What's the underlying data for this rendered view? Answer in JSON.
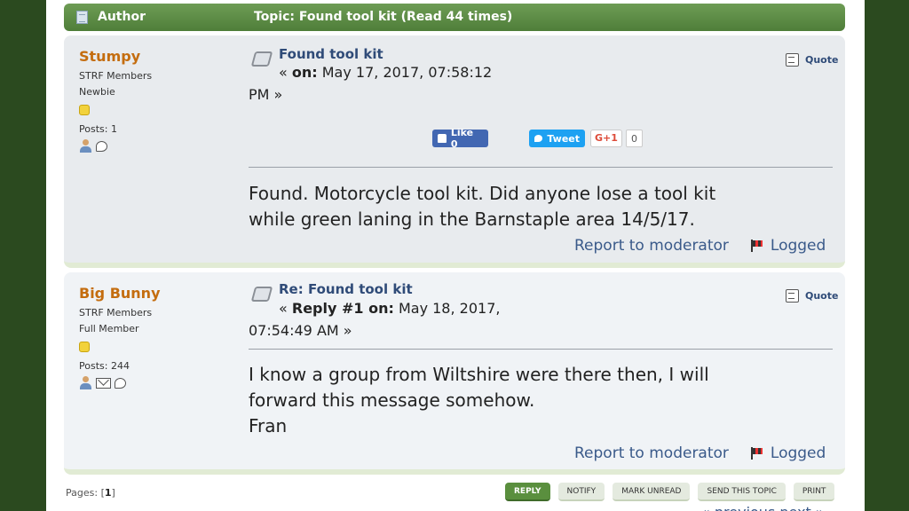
{
  "header": {
    "author_label": "Author",
    "topic_label": "Topic: Found tool kit  (Read 44 times)"
  },
  "posts": [
    {
      "name": "Stumpy",
      "group": "STRF Members",
      "rank": "Newbie",
      "posts_label": "Posts: 1",
      "subject": "Found tool kit",
      "date_prefix": "« ",
      "date_on": "on:",
      "date_line1": " May 17, 2017, 07:58:12",
      "date_line2": "PM »",
      "quote_label": "Quote",
      "social": {
        "like": "Like 0",
        "tweet": "Tweet",
        "gplus": "G+1",
        "gplus_count": "0"
      },
      "body": "Found. Motorcycle tool kit. Did anyone lose a tool kit\nwhile green laning in the Barnstaple area 14/5/17.",
      "report_label": "Report to moderator",
      "logged_label": "Logged"
    },
    {
      "name": "Big Bunny",
      "group": "STRF Members",
      "rank": "Full Member",
      "posts_label": "Posts: 244",
      "subject": "Re: Found tool kit",
      "date_prefix": "« ",
      "date_on": "Reply #1 on:",
      "date_line1": " May 18, 2017,",
      "date_line2": "07:54:49 AM »",
      "quote_label": "Quote",
      "body": "I know a group from Wiltshire were there then,  I will\nforward this message somehow.\nFran",
      "report_label": "Report to moderator",
      "logged_label": "Logged"
    }
  ],
  "pagination": {
    "label": "Pages: [",
    "current": "1",
    "close": "]"
  },
  "buttons": [
    "REPLY",
    "NOTIFY",
    "MARK UNREAD",
    "SEND THIS TOPIC",
    "PRINT"
  ],
  "nav": "« previous next »",
  "colors": {
    "background": "#2b4a1f",
    "header_bar": "#5a8f3e",
    "username": "#c46d0f",
    "link": "#2f4b78"
  }
}
